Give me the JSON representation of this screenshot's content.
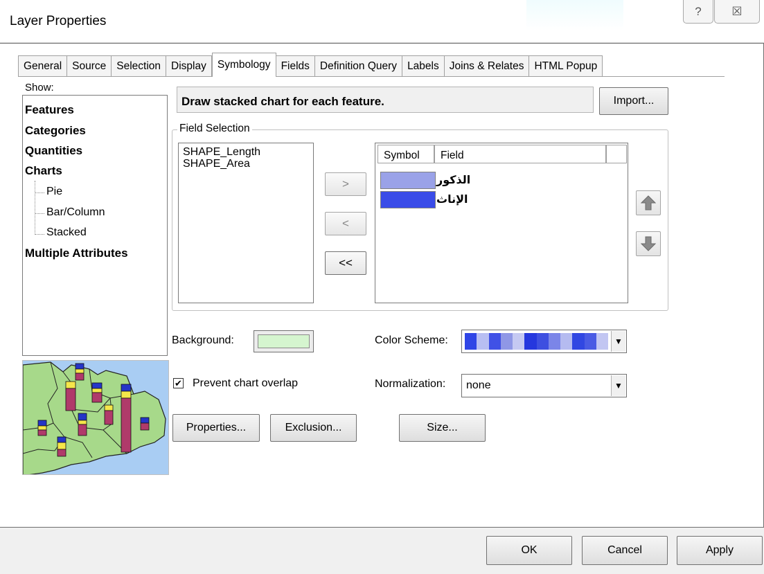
{
  "window": {
    "title": "Layer Properties",
    "help_glyph": "?",
    "close_glyph": "☒"
  },
  "tabs": [
    {
      "label": "General"
    },
    {
      "label": "Source"
    },
    {
      "label": "Selection"
    },
    {
      "label": "Display"
    },
    {
      "label": "Symbology",
      "active": true
    },
    {
      "label": "Fields"
    },
    {
      "label": "Definition Query"
    },
    {
      "label": "Labels"
    },
    {
      "label": "Joins & Relates"
    },
    {
      "label": "HTML Popup"
    }
  ],
  "show": {
    "label": "Show:",
    "items": [
      "Features",
      "Categories",
      "Quantities",
      "Charts",
      "Multiple Attributes"
    ],
    "chart_subitems": [
      "Pie",
      "Bar/Column",
      "Stacked"
    ]
  },
  "description": "Draw stacked chart for each feature.",
  "import_label": "Import...",
  "field_selection": {
    "label": "Field Selection",
    "available_fields": [
      "SHAPE_Length",
      "SHAPE_Area"
    ],
    "add_label": ">",
    "remove_label": "<",
    "remove_all_label": "<<",
    "table_headers": {
      "symbol": "Symbol",
      "field": "Field"
    },
    "selected_fields": [
      {
        "field": "الذكور",
        "color": "#9aa2e8"
      },
      {
        "field": "الإناث",
        "color": "#3a4ce8"
      }
    ]
  },
  "background": {
    "label": "Background:",
    "color": "#d5f5cf"
  },
  "color_scheme": {
    "label": "Color  Scheme:",
    "ramp": [
      "#2f45e6",
      "#b8bef2",
      "#4051e6",
      "#8f97e6",
      "#c5c9f2",
      "#2537de",
      "#3e4fe0",
      "#7b85e8",
      "#b5bbf0",
      "#3147e2",
      "#4a5be4",
      "#c2c6f2"
    ]
  },
  "prevent_overlap": {
    "label": "Prevent chart overlap",
    "checked": true,
    "check_glyph": "✔"
  },
  "normalization": {
    "label": "Normalization:",
    "value": "none"
  },
  "buttons": {
    "properties": "Properties...",
    "exclusion": "Exclusion...",
    "size": "Size..."
  },
  "dialog_buttons": {
    "ok": "OK",
    "cancel": "Cancel",
    "apply": "Apply"
  }
}
